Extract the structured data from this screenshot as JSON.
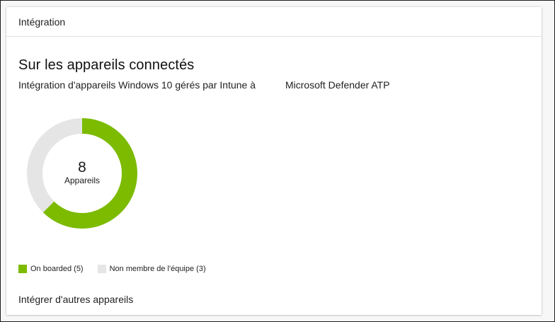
{
  "header": {
    "title": "Intégration"
  },
  "main": {
    "title": "Sur les appareils connectés",
    "subtitle": "Intégration d'appareils Windows 10 gérés par Intune à",
    "subtitle_target": "Microsoft Defender ATP"
  },
  "donut": {
    "count": "8",
    "count_label": "Appareils"
  },
  "legend": [
    {
      "label": "On boarded (5)",
      "color": "#7cbb00"
    },
    {
      "label": "Non membre de l'équipe (3)",
      "color": "#e5e5e5"
    }
  ],
  "chart_data": {
    "type": "pie",
    "categories": [
      "On boarded",
      "Non membre de l'équipe"
    ],
    "values": [
      5,
      3
    ],
    "colors": [
      "#7cbb00",
      "#e5e5e5"
    ],
    "total": 8,
    "legend_position": "bottom-left"
  },
  "footer": {
    "link_label": "Intégrer d'autres appareils"
  }
}
